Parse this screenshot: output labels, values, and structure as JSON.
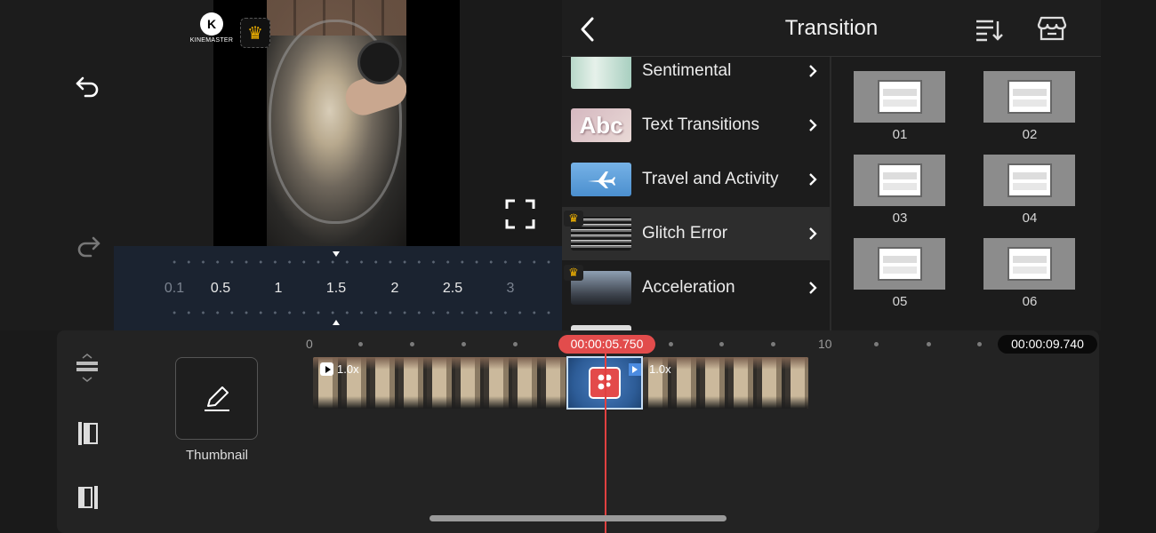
{
  "preview": {
    "watermark_text": "KINEMASTER",
    "watermark_letter": "K"
  },
  "speed_ruler": {
    "ticks": [
      "0.1",
      "0.5",
      "1",
      "1.5",
      "2",
      "2.5",
      "3"
    ],
    "selected": "1.5"
  },
  "transition_panel": {
    "title": "Transition",
    "categories": [
      {
        "label": "Sentimental",
        "premium": false,
        "selected": false
      },
      {
        "label": "Text Transitions",
        "premium": false,
        "selected": false
      },
      {
        "label": "Travel and Activity",
        "premium": false,
        "selected": false
      },
      {
        "label": "Glitch Error",
        "premium": true,
        "selected": true
      },
      {
        "label": "Acceleration",
        "premium": true,
        "selected": false
      }
    ],
    "text_thumb_word": "Abc",
    "effects": [
      "01",
      "02",
      "03",
      "04",
      "05",
      "06"
    ]
  },
  "timeline": {
    "thumbnail_label": "Thumbnail",
    "ruler_marks": [
      "0",
      "10"
    ],
    "current_time": "00:00:05.750",
    "end_time": "00:00:09.740",
    "clips": [
      {
        "speed": "1.0x"
      },
      {
        "speed": "1.0x"
      }
    ]
  },
  "colors": {
    "accent_red": "#e24c4c",
    "premium_gold": "#f4b400",
    "transition_blue": "#2d5c97"
  }
}
